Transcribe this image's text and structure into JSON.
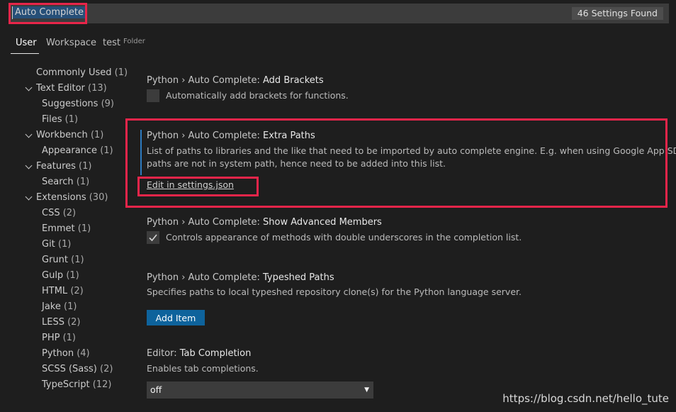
{
  "search": {
    "value": "Auto Complete",
    "count_badge": "46 Settings Found"
  },
  "tabs": [
    {
      "label": "User"
    },
    {
      "label": "Workspace"
    },
    {
      "label": "test",
      "sub": "Folder"
    }
  ],
  "tree": [
    {
      "label": "Commonly Used",
      "count": "(1)",
      "expanded": false
    },
    {
      "label": "Text Editor",
      "count": "(13)",
      "expanded": true
    },
    {
      "label": "Suggestions",
      "count": "(9)"
    },
    {
      "label": "Files",
      "count": "(1)"
    },
    {
      "label": "Workbench",
      "count": "(1)",
      "expanded": true
    },
    {
      "label": "Appearance",
      "count": "(1)"
    },
    {
      "label": "Features",
      "count": "(1)",
      "expanded": true
    },
    {
      "label": "Search",
      "count": "(1)"
    },
    {
      "label": "Extensions",
      "count": "(30)",
      "expanded": true
    },
    {
      "label": "CSS",
      "count": "(2)"
    },
    {
      "label": "Emmet",
      "count": "(1)"
    },
    {
      "label": "Git",
      "count": "(1)"
    },
    {
      "label": "Grunt",
      "count": "(1)"
    },
    {
      "label": "Gulp",
      "count": "(1)"
    },
    {
      "label": "HTML",
      "count": "(2)"
    },
    {
      "label": "Jake",
      "count": "(1)"
    },
    {
      "label": "LESS",
      "count": "(2)"
    },
    {
      "label": "PHP",
      "count": "(1)"
    },
    {
      "label": "Python",
      "count": "(4)"
    },
    {
      "label": "SCSS (Sass)",
      "count": "(2)"
    },
    {
      "label": "TypeScript",
      "count": "(12)"
    }
  ],
  "settings": {
    "add_brackets": {
      "prefix": "Python › Auto Complete: ",
      "name": "Add Brackets",
      "description": "Automatically add brackets for functions.",
      "checked": false
    },
    "extra_paths": {
      "prefix": "Python › Auto Complete: ",
      "name": "Extra Paths",
      "description_line1": "List of paths to libraries and the like that need to be imported by auto complete engine. E.g. when using Google App SDK, the",
      "description_line2": "paths are not in system path, hence need to be added into this list.",
      "link": "Edit in settings.json"
    },
    "show_advanced": {
      "prefix": "Python › Auto Complete: ",
      "name": "Show Advanced Members",
      "description": "Controls appearance of methods with double underscores in the completion list.",
      "checked": true
    },
    "typeshed": {
      "prefix": "Python › Auto Complete: ",
      "name": "Typeshed Paths",
      "description": "Specifies paths to local typeshed repository clone(s) for the Python language server.",
      "button": "Add Item"
    },
    "tab_completion": {
      "prefix": "Editor: ",
      "name": "Tab Completion",
      "description": "Enables tab completions.",
      "value": "off"
    }
  },
  "watermark": "https://blog.csdn.net/hello_tute",
  "colors": {
    "background": "#1e1e1e",
    "accent_button": "#0e639c",
    "annotation_red": "#e8254a",
    "focus_bar": "#2d7bbf"
  }
}
